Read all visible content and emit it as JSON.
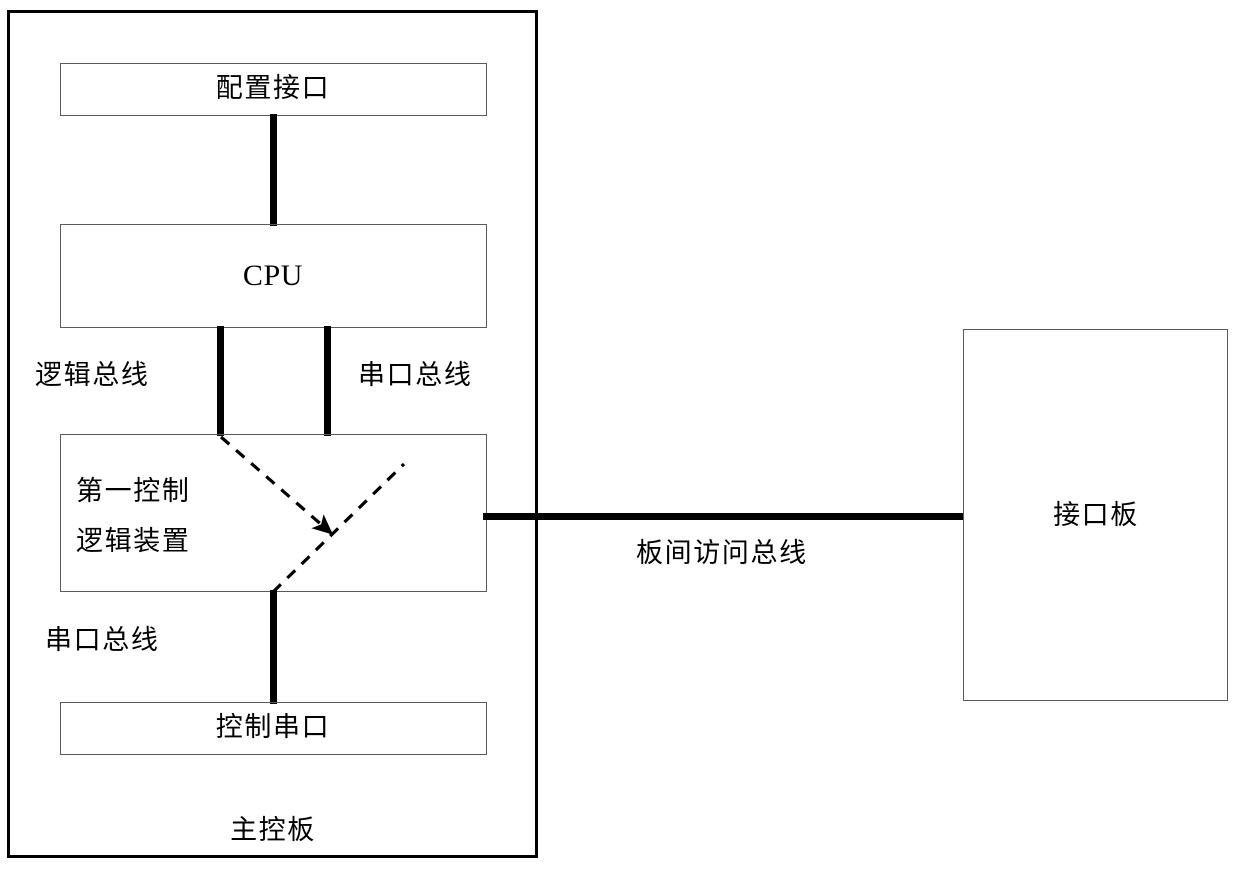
{
  "diagram": {
    "title_label": "主控板",
    "boards": {
      "main_board": {
        "name": "主控板",
        "label": "主控板"
      },
      "interface_board": {
        "name": "接口板",
        "label": "接口板"
      }
    },
    "units": [
      {
        "id": "config-interface",
        "label": "配置接口"
      },
      {
        "id": "cpu",
        "label": "CPU"
      },
      {
        "id": "first-control-logic-device",
        "label_line1": "第一控制",
        "label_line2": "逻辑装置"
      },
      {
        "id": "control-serial-port",
        "label": "控制串口"
      }
    ],
    "bus_labels": {
      "logic_bus": "逻辑总线",
      "serial_bus_upper": "串口总线",
      "serial_bus_lower": "串口总线",
      "inter_board_bus": "板间访问总线"
    },
    "connections": [
      {
        "id": "config-to-cpu",
        "from": "配置接口",
        "to": "CPU",
        "style": "solid"
      },
      {
        "id": "cpu-to-logic-via-logic-bus",
        "from": "CPU",
        "to": "第一控制逻辑装置",
        "bus": "逻辑总线",
        "style": "solid"
      },
      {
        "id": "cpu-to-logic-via-serial-bus",
        "from": "CPU",
        "to": "第一控制逻辑装置",
        "bus": "串口总线",
        "style": "solid"
      },
      {
        "id": "logic-to-control-serial-port",
        "from": "第一控制逻辑装置",
        "to": "控制串口",
        "bus": "串口总线",
        "style": "solid"
      },
      {
        "id": "main-board-to-interface-board",
        "from": "第一控制逻辑装置",
        "to": "接口板",
        "bus": "板间访问总线",
        "style": "solid"
      },
      {
        "id": "dashed-flow-logic-bus-inbound",
        "style": "dashed",
        "arrow": true
      },
      {
        "id": "dashed-flow-serial-crossing",
        "style": "dashed",
        "arrow": false
      }
    ],
    "colors": {
      "stroke": "#000000",
      "box_stroke": "#5a5a5a",
      "background": "#ffffff"
    }
  }
}
